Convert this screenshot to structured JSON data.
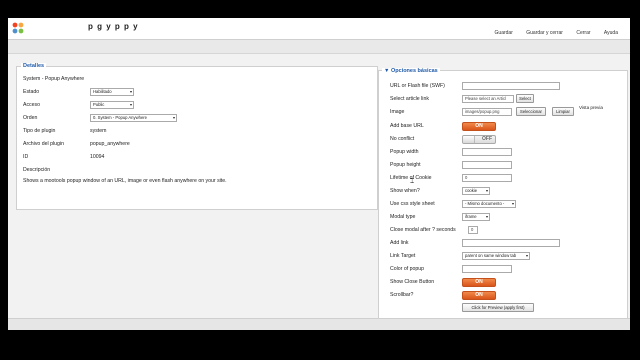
{
  "header": {
    "title_fragment": "p  g     y   p  p   y",
    "links": [
      "Guardar",
      "Guardar y cerrar",
      "Cerrar",
      "Ayuda"
    ]
  },
  "details": {
    "legend": "Detalles",
    "plugin_name": "System - Popup Anywhere",
    "estado_label": "Estado",
    "estado_value": "Habilitado",
    "acceso_label": "Acceso",
    "acceso_value": "Public",
    "orden_label": "Orden",
    "orden_value": "0. System - Popup Anywhere",
    "tipo_label": "Tipo de plugin",
    "tipo_value": "system",
    "archivo_label": "Archivo del plugin",
    "archivo_value": "popup_anywhere",
    "id_label": "ID",
    "id_value": "10094",
    "descripcion_label": "Descripción",
    "descripcion_text": "Shows a mootools popup window of an URL, image or even flash anywhere on your site."
  },
  "options": {
    "legend": "▼ Opciones básicas",
    "url_label": "URL or Flash file (SWF)",
    "url_value": "",
    "select_link_label": "Select article link",
    "select_link_value": "Please select an Articl",
    "select_button": "Select",
    "image_label": "Image",
    "image_value": "images/popup.png",
    "seleccionar_button": "Seleccionar",
    "limpiar_button": "Limpiar",
    "vista_previa": "Vista previa",
    "add_base_url_label": "Add base URL",
    "add_base_url_state": "ON",
    "no_conflict_label": "No conflict",
    "no_conflict_state": "OFF",
    "popup_width_label": "Popup width",
    "popup_width_value": "",
    "popup_height_label": "Popup height",
    "popup_height_value": "",
    "lifetime_label": "Lifetime of Cookie",
    "lifetime_value": "0",
    "show_when_label": "Show when?",
    "show_when_value": "cookie",
    "css_label": "Use css style sheet",
    "css_value": "- Mismo documento -",
    "modal_type_label": "Modal type",
    "modal_type_value": "iframe",
    "close_modal_label": "Close modal after ? seconds",
    "close_modal_value": "0",
    "add_link_label": "Add link",
    "add_link_value": "",
    "link_target_label": "Link Target",
    "link_target_value": "parent on same window tab",
    "color_label": "Color of popup",
    "color_value": "",
    "show_close_label": "Show Close Button",
    "show_close_state": "ON",
    "scrollbar_label": "Scrollbar?",
    "scrollbar_state": "ON",
    "preview_button": "Click for Preview (apply first)"
  }
}
